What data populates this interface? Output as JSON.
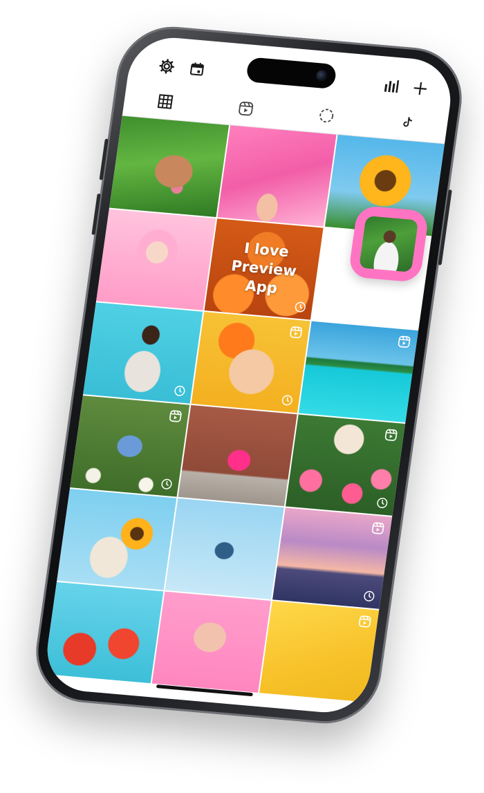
{
  "topbar": {
    "left_icons": [
      "gear-icon",
      "calendar-icon"
    ],
    "right_icons": [
      "bar-chart-icon",
      "plus-icon"
    ]
  },
  "tabs": [
    {
      "name": "grid",
      "icon": "grid-icon",
      "active": true
    },
    {
      "name": "reels",
      "icon": "reels-icon",
      "active": false
    },
    {
      "name": "stories",
      "icon": "story-circle-icon",
      "active": false
    },
    {
      "name": "tiktok",
      "icon": "tiktok-icon",
      "active": false
    }
  ],
  "overlay_post": {
    "lines": [
      "I love",
      "Preview",
      "App"
    ]
  },
  "colors": {
    "accent_pink": "#ff74c2",
    "divider": "#e2e2e2",
    "icon": "#1a1a1a"
  }
}
